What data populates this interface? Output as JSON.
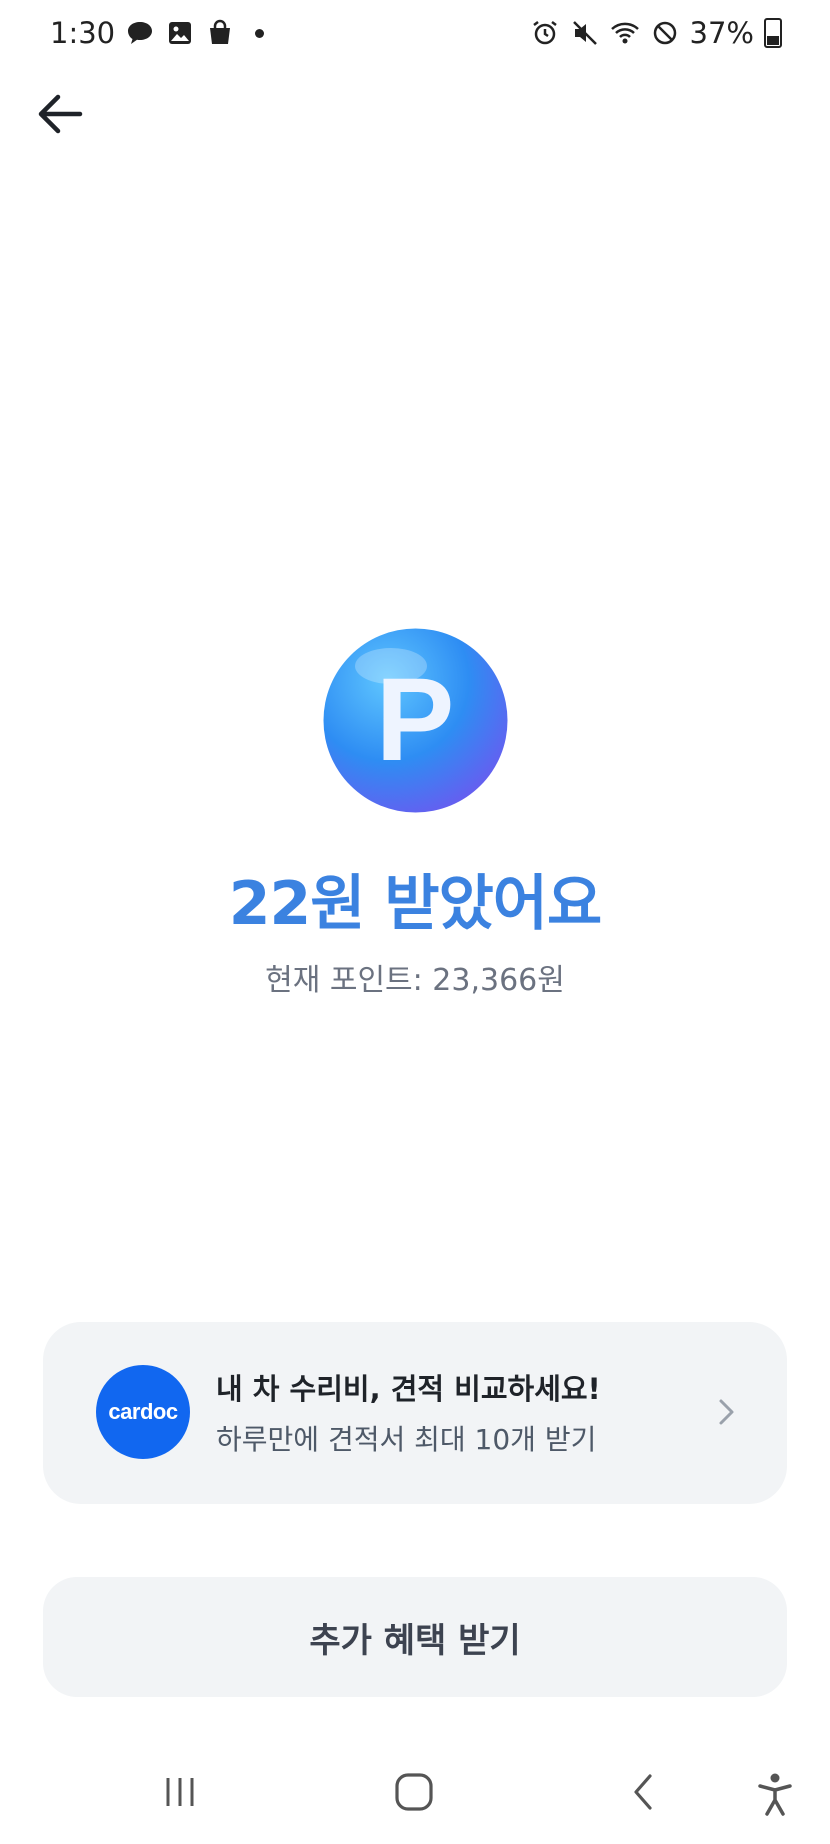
{
  "status_bar": {
    "time": "1:30",
    "left_icons": [
      "chat-bubble-icon",
      "gallery-icon",
      "shopping-bag-icon",
      "notification-dot-icon"
    ],
    "right_icons": [
      "alarm-icon",
      "mute-icon",
      "wifi-icon",
      "do-not-disturb-icon",
      "battery-icon"
    ],
    "battery_percent": "37%"
  },
  "header": {
    "back_icon": "arrow-left-icon"
  },
  "reward": {
    "coin_letter": "P",
    "headline": "22원 받았어요",
    "current_points": "현재 포인트: 23,366원"
  },
  "promo": {
    "logo_text": "cardoc",
    "title": "내 차 수리비, 견적 비교하세요!",
    "description": "하루만에 견적서 최대 10개 받기",
    "chevron_icon": "chevron-right-icon"
  },
  "cta": {
    "label": "추가 혜택 받기"
  },
  "nav_bar": {
    "buttons": [
      "recent-apps-icon",
      "home-icon",
      "back-icon",
      "accessibility-icon"
    ]
  },
  "colors": {
    "accent": "#3b82e0",
    "promo_logo": "#1167f0",
    "card_bg": "#f2f4f6"
  }
}
